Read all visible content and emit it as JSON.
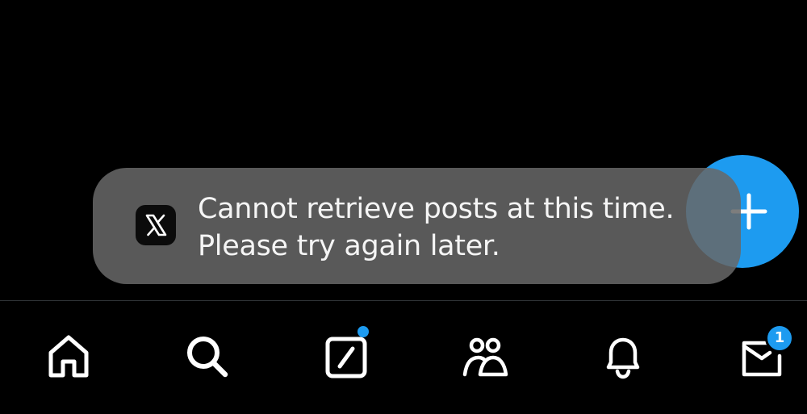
{
  "toast": {
    "icon": "x-logo-icon",
    "line1": "Cannot retrieve posts at this time.",
    "line2": "Please try again later."
  },
  "fab": {
    "icon": "plus-icon"
  },
  "tabbar": {
    "items": [
      {
        "icon": "home-icon"
      },
      {
        "icon": "search-icon"
      },
      {
        "icon": "grok-icon",
        "has_dot": true
      },
      {
        "icon": "communities-icon"
      },
      {
        "icon": "notifications-bell-icon"
      },
      {
        "icon": "messages-envelope-icon",
        "badge": "1"
      }
    ]
  },
  "colors": {
    "background": "#000000",
    "accent": "#1d9bf0",
    "toast_bg": "#5a5a5a",
    "text": "#f5f5f5"
  }
}
